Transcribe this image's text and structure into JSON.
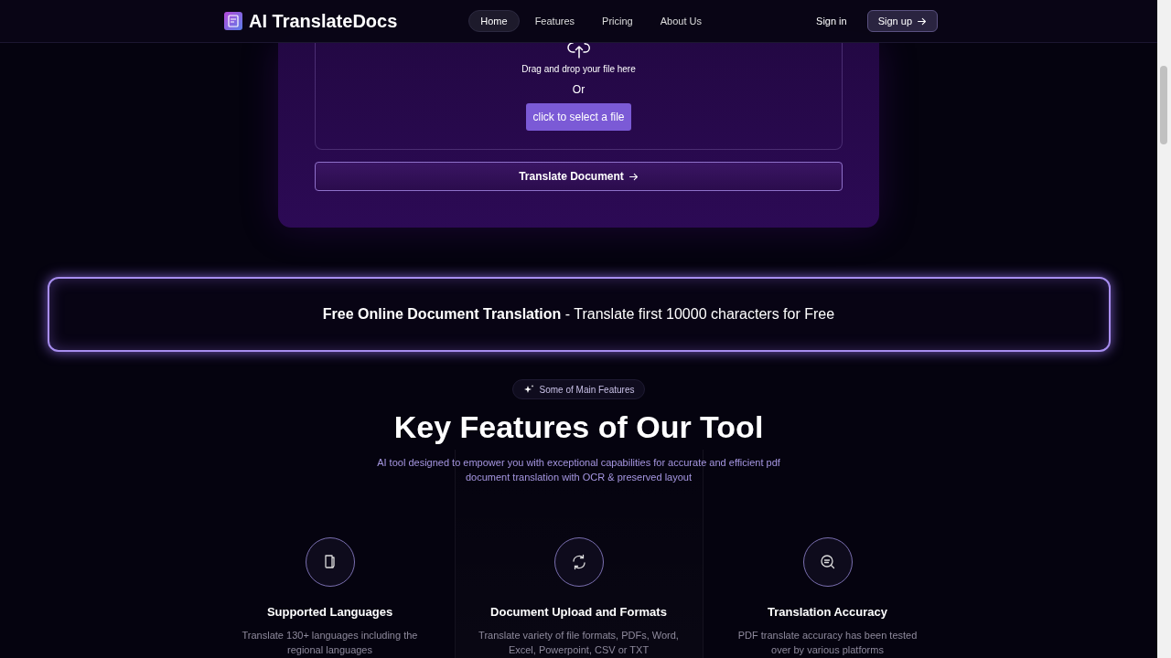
{
  "nav": {
    "logo": "AI TranslateDocs",
    "links": [
      {
        "label": "Home",
        "selected": true
      },
      {
        "label": "Features",
        "selected": false
      },
      {
        "label": "Pricing",
        "selected": false
      },
      {
        "label": "About Us",
        "selected": false
      }
    ],
    "sign_in": "Sign in",
    "sign_up": "Sign up"
  },
  "upload": {
    "drop_text": "Drag and drop your file here",
    "or": "Or",
    "select_button": "click to select a file",
    "translate_button": "Translate Document"
  },
  "banner": {
    "bold": "Free Online Document Translation",
    "text": " - Translate first 10000 characters for Free"
  },
  "features": {
    "badge": "Some of Main Features",
    "title": "Key Features of Our Tool",
    "subtitle": "AI tool designed to empower you with exceptional capabilities for accurate and efficient pdf document translation with OCR & preserved layout",
    "items": [
      {
        "kind": "document",
        "title": "Supported Languages",
        "text": "Translate 130+ languages including the regional languages",
        "selected": false
      },
      {
        "kind": "sync",
        "title": "Document Upload and Formats",
        "text": "Translate variety of file formats, PDFs, Word, Excel, Powerpoint, CSV or TXT",
        "selected": true
      },
      {
        "kind": "search",
        "title": "Translation Accuracy",
        "text": "PDF translate accuracy has been tested over by various platforms",
        "selected": false
      }
    ]
  }
}
